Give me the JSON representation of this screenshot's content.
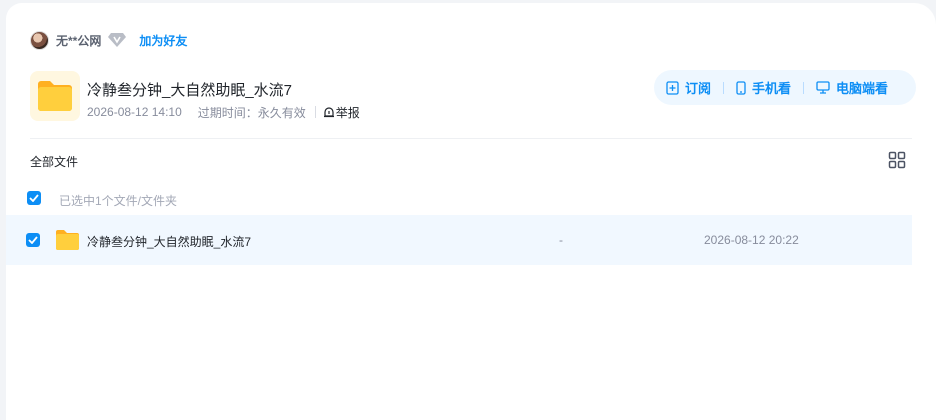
{
  "user": {
    "name": "无**公网",
    "add_friend": "加为好友"
  },
  "share": {
    "title": "冷静叁分钟_大自然助眠_水流7",
    "created": "2026-08-12 14:10",
    "expiry": "过期时间：永久有效",
    "report": "举报"
  },
  "actions": {
    "subscribe": "订阅",
    "mobile": "手机看",
    "desktop": "电脑端看"
  },
  "breadcrumb": "全部文件",
  "selection_text": "已选中1个文件/文件夹",
  "files": [
    {
      "name": "冷静叁分钟_大自然助眠_水流7",
      "size": "-",
      "time": "2026-08-12 20:22",
      "selected": true
    }
  ],
  "colors": {
    "accent": "#0d8ef5",
    "row_highlight": "#f1f8ff",
    "folder": "#ffc933"
  }
}
